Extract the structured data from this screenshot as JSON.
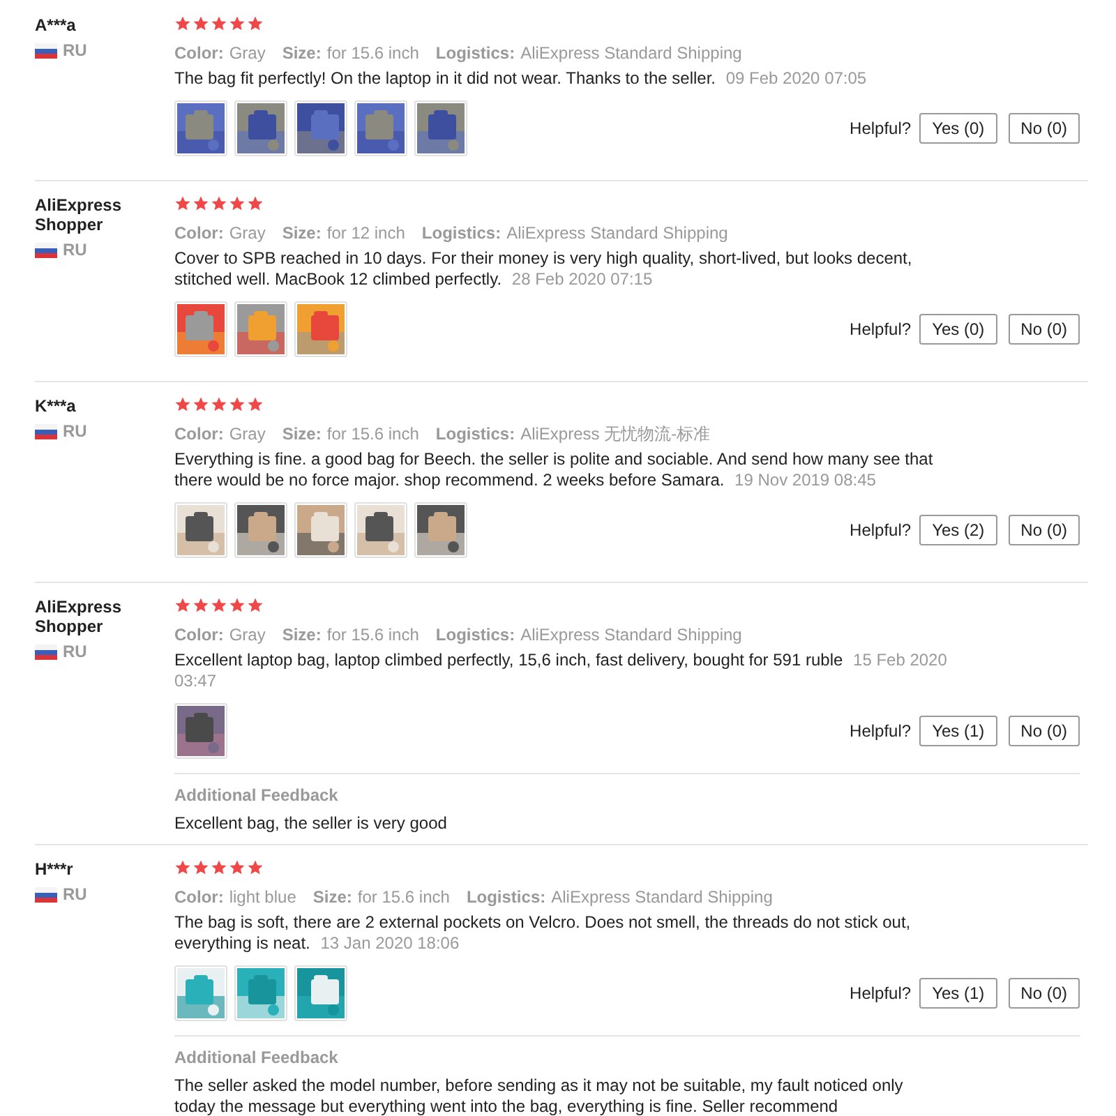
{
  "reviews": [
    {
      "name": "A***a",
      "country": "RU",
      "stars": 5,
      "color_label": "Color:",
      "color_value": "Gray",
      "size_label": "Size:",
      "size": "for 15.6 inch",
      "logistics_label": "Logistics:",
      "logistics": "AliExpress Standard Shipping",
      "text": "The bag fit perfectly! On the laptop in it did not wear. Thanks to the seller.",
      "date": "09 Feb 2020 07:05",
      "photos": [
        {
          "kind": "picture"
        },
        {
          "kind": "picture"
        },
        {
          "kind": "picture"
        },
        {
          "kind": "picture"
        },
        {
          "kind": "picture"
        }
      ],
      "helpful": "Helpful?",
      "yes": "Yes (0)",
      "no": "No (0)"
    },
    {
      "name": "AliExpress Shopper",
      "country": "RU",
      "stars": 5,
      "color_label": "Color:",
      "color_value": "Gray",
      "size_label": "Size:",
      "size": "for 12 inch",
      "logistics_label": "Logistics:",
      "logistics": "AliExpress Standard Shipping",
      "text": "Cover to SPB reached in 10 days. For their money is very high quality, short-lived, but looks decent, stitched well. MacBook 12 climbed perfectly.",
      "date": "28 Feb 2020 07:15",
      "photos": [
        {
          "kind": "picture"
        },
        {
          "kind": "picture"
        },
        {
          "kind": "picture"
        }
      ],
      "helpful": "Helpful?",
      "yes": "Yes (0)",
      "no": "No (0)"
    },
    {
      "name": "K***a",
      "country": "RU",
      "stars": 5,
      "color_label": "Color:",
      "color_value": "Gray",
      "size_label": "Size:",
      "size": "for 15.6 inch",
      "logistics_label": "Logistics:",
      "logistics": "AliExpress 无忧物流-标准",
      "text": "Everything is fine. a good bag for Beech. the seller is polite and sociable. And send how many see that there would be no force major. shop recommend. 2 weeks before Samara.",
      "date": "19 Nov 2019 08:45",
      "photos": [
        {
          "kind": "picture"
        },
        {
          "kind": "picture"
        },
        {
          "kind": "picture"
        },
        {
          "kind": "picture"
        },
        {
          "kind": "picture"
        }
      ],
      "helpful": "Helpful?",
      "yes": "Yes (2)",
      "no": "No (0)"
    },
    {
      "name": "AliExpress Shopper",
      "country": "RU",
      "stars": 5,
      "color_label": "Color:",
      "color_value": "Gray",
      "size_label": "Size:",
      "size": "for 15.6 inch",
      "logistics_label": "Logistics:",
      "logistics": "AliExpress Standard Shipping",
      "text": "Excellent laptop bag, laptop climbed perfectly, 15,6 inch, fast delivery, bought for 591 ruble",
      "date": "15 Feb 2020 03:47",
      "photos": [
        {
          "kind": "picture"
        }
      ],
      "helpful": "Helpful?",
      "yes": "Yes (1)",
      "no": "No (0)",
      "additional": {
        "label": "Additional Feedback",
        "text": "Excellent bag, the seller is very good"
      }
    },
    {
      "name": "H***r",
      "country": "RU",
      "stars": 5,
      "color_label": "Color:",
      "color_value": "light blue",
      "size_label": "Size:",
      "size": "for 15.6 inch",
      "logistics_label": "Logistics:",
      "logistics": "AliExpress Standard Shipping",
      "text": "The bag is soft, there are 2 external pockets on Velcro. Does not smell, the threads do not stick out, everything is neat.",
      "date": "13 Jan 2020 18:06",
      "photos": [
        {
          "kind": "picture"
        },
        {
          "kind": "picture"
        },
        {
          "kind": "picture"
        }
      ],
      "helpful": "Helpful?",
      "yes": "Yes (1)",
      "no": "No (0)",
      "additional": {
        "label": "Additional Feedback",
        "text": "The seller asked the model number, before sending as it may not be suitable, my fault noticed only today the message but everything went into the bag, everything is fine. Seller recommend"
      }
    }
  ]
}
